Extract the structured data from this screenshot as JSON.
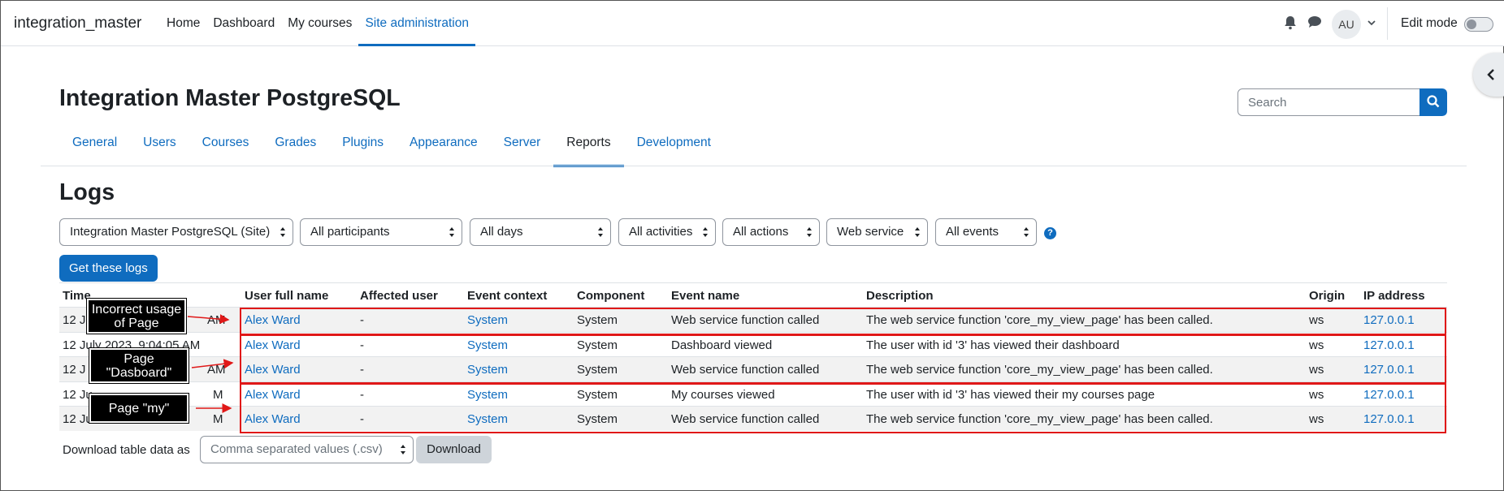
{
  "navbar": {
    "site_name": "integration_master",
    "items": [
      {
        "label": "Home"
      },
      {
        "label": "Dashboard"
      },
      {
        "label": "My courses"
      },
      {
        "label": "Site administration",
        "active": true
      }
    ],
    "avatar_initials": "AU",
    "edit_mode_label": "Edit mode",
    "edit_mode_on": false
  },
  "header": {
    "title": "Integration Master PostgreSQL",
    "search_placeholder": "Search"
  },
  "tabs": [
    {
      "label": "General"
    },
    {
      "label": "Users"
    },
    {
      "label": "Courses"
    },
    {
      "label": "Grades"
    },
    {
      "label": "Plugins"
    },
    {
      "label": "Appearance"
    },
    {
      "label": "Server"
    },
    {
      "label": "Reports",
      "active": true
    },
    {
      "label": "Development"
    }
  ],
  "logs": {
    "heading": "Logs",
    "filters": {
      "site": "Integration Master PostgreSQL (Site)",
      "participants": "All participants",
      "days": "All days",
      "activities": "All activities",
      "actions": "All actions",
      "origin": "Web service",
      "events": "All events"
    },
    "help_symbol": "?",
    "get_logs_label": "Get these logs",
    "columns": [
      "Time",
      "User full name",
      "Affected user",
      "Event context",
      "Component",
      "Event name",
      "Description",
      "Origin",
      "IP address"
    ],
    "rows": [
      {
        "time": "12 J",
        "time_tail": "AM",
        "user": "Alex Ward",
        "affected": "-",
        "context": "System",
        "component": "System",
        "event": "Web service function called",
        "description": "The web service function 'core_my_view_page' has been called.",
        "origin": "ws",
        "ip": "127.0.0.1"
      },
      {
        "time": "12 July 2023, 9:04:05 AM",
        "time_tail": "",
        "user": "Alex Ward",
        "affected": "-",
        "context": "System",
        "component": "System",
        "event": "Dashboard viewed",
        "description": "The user with id '3' has viewed their dashboard",
        "origin": "ws",
        "ip": "127.0.0.1"
      },
      {
        "time": "12 J",
        "time_tail": "AM",
        "user": "Alex Ward",
        "affected": "-",
        "context": "System",
        "component": "System",
        "event": "Web service function called",
        "description": "The web service function 'core_my_view_page' has been called.",
        "origin": "ws",
        "ip": "127.0.0.1"
      },
      {
        "time": "12 Ju",
        "time_tail": "M",
        "user": "Alex Ward",
        "affected": "-",
        "context": "System",
        "component": "System",
        "event": "My courses viewed",
        "description": "The user with id '3' has viewed their my courses page",
        "origin": "ws",
        "ip": "127.0.0.1"
      },
      {
        "time": "12 Ju",
        "time_tail": "M",
        "user": "Alex Ward",
        "affected": "-",
        "context": "System",
        "component": "System",
        "event": "Web service function called",
        "description": "The web service function 'core_my_view_page' has been called.",
        "origin": "ws",
        "ip": "127.0.0.1"
      }
    ],
    "download_label": "Download table data as",
    "download_format": "Comma separated values (.csv)",
    "download_button": "Download"
  },
  "annotations": {
    "callout_1": "Incorrect usage of Page",
    "callout_2": "Page \"Dasboard\"",
    "callout_3": "Page \"my\"",
    "highlight_color": "#e01818"
  },
  "colors": {
    "brand": "#0f6cbf",
    "text": "#1d2125"
  }
}
